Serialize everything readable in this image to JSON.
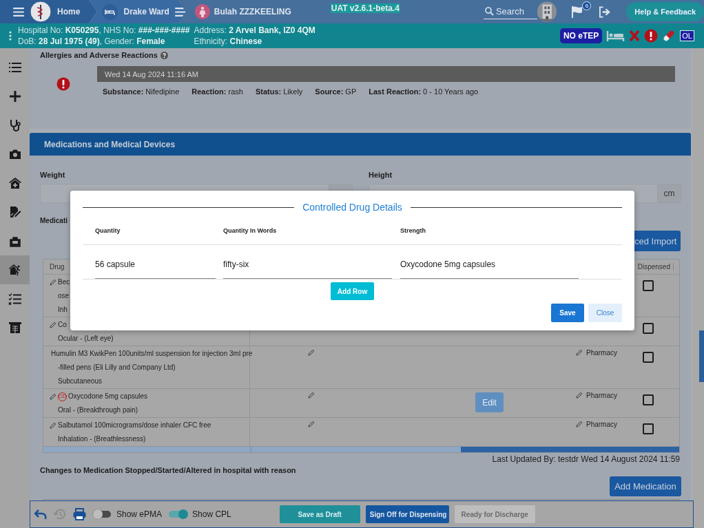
{
  "header": {
    "home": "Home",
    "ward": "Drake Ward",
    "patient_name": "Bulah ZZZKEELING",
    "version": "UAT v2.6.1-beta.4",
    "search_placeholder": "Search",
    "notification_count": "6",
    "help_button": "Help & Feedback"
  },
  "patient_bar": {
    "left": [
      "Hospital No: **K050295**, NHS No: **###-###-####**",
      "DoB: **28 Jul 1975 (49)**, Gender: **Female**"
    ],
    "right": [
      "Address: **2 Arvel Bank, IZ0 4QM**",
      "Ethnicity: **Chinese**"
    ],
    "status_icons": [
      {
        "kind": "badge",
        "text": "NO eTEP"
      },
      {
        "kind": "bed"
      },
      {
        "kind": "cross"
      },
      {
        "kind": "alert"
      },
      {
        "kind": "pill"
      },
      {
        "kind": "square",
        "text": "OL"
      }
    ]
  },
  "sidebar": {
    "items": [
      {
        "selected": false
      },
      {
        "selected": false
      },
      {
        "selected": false
      },
      {
        "selected": false
      },
      {
        "selected": false
      },
      {
        "selected": false
      },
      {
        "selected": false
      },
      {
        "selected": true
      },
      {
        "selected": false
      },
      {
        "selected": false
      }
    ]
  },
  "allergies": {
    "title": "Allergies and Adverse Reactions",
    "date": "Wed 14 Aug 2024 11:16 AM",
    "details": [
      {
        "label": "Substance:",
        "value": "Nifedipine"
      },
      {
        "label": "Reaction:",
        "value": "rash"
      },
      {
        "label": "Status:",
        "value": "Likely"
      },
      {
        "label": "Source:",
        "value": "GP"
      },
      {
        "label": "Last Reaction:",
        "value": "0 - 10 Years ago"
      }
    ]
  },
  "medications": {
    "title": "Medications and Medical Devices",
    "weight_label": "Weight",
    "height_label": "Height",
    "height_unit": "cm",
    "list_label": "Medicati",
    "import_button": "ced Import",
    "columns": [
      "Drug",
      "Dispensed"
    ],
    "rows": [
      {
        "drug_lines": [
          "Bec",
          "ose",
          "Inh"
        ],
        "controlled": false,
        "checked": false
      },
      {
        "drug_lines": [
          "Co",
          "Ocular - (Left eye)"
        ],
        "controlled": false,
        "checked": false
      },
      {
        "drug_lines": [
          "Humulin M3 KwikPen 100units/ml suspension for injection 3ml pre",
          "-filled pens (Eli Lilly and Company Ltd)",
          "Subcutaneous"
        ],
        "controlled": false,
        "checked": false,
        "source": "Pharmacy"
      },
      {
        "drug_lines": [
          "Oxycodone 5mg capsules",
          "Oral - (Breakthrough pain)"
        ],
        "controlled": true,
        "cd_label": "CD",
        "checked": false,
        "source": "Pharmacy",
        "action": "Edit"
      },
      {
        "drug_lines": [
          "Salbutamol 100micrograms/dose inhaler CFC free",
          "Inhalation - (Breathlessness)"
        ],
        "controlled": false,
        "checked": false,
        "source": "Pharmacy"
      }
    ],
    "last_updated": "Last Updated By: testdr Wed 14 August 2024 11:59",
    "changes_title": "Changes to Medication Stopped/Started/Altered in hospital with reason",
    "add_button": "Add Medication"
  },
  "modal": {
    "title": "Controlled Drug Details",
    "columns": [
      "Quantity",
      "Quantity In Words",
      "Strength"
    ],
    "values": [
      "56 capsule",
      "fifty-six",
      "Oxycodone 5mg capsules"
    ],
    "add_row": "Add Row",
    "save": "Save",
    "close": "Close"
  },
  "toolbar": {
    "toggles": [
      {
        "label": "Show ePMA",
        "on": false
      },
      {
        "label": "Show CPL",
        "on": true
      }
    ],
    "buttons": [
      {
        "label": "Save as Draft",
        "kind": "draft",
        "disabled": false
      },
      {
        "label": "Sign Off for Dispensing",
        "kind": "primary",
        "disabled": false
      },
      {
        "label": "Ready for Discharge",
        "kind": "primary",
        "disabled": true
      }
    ]
  }
}
